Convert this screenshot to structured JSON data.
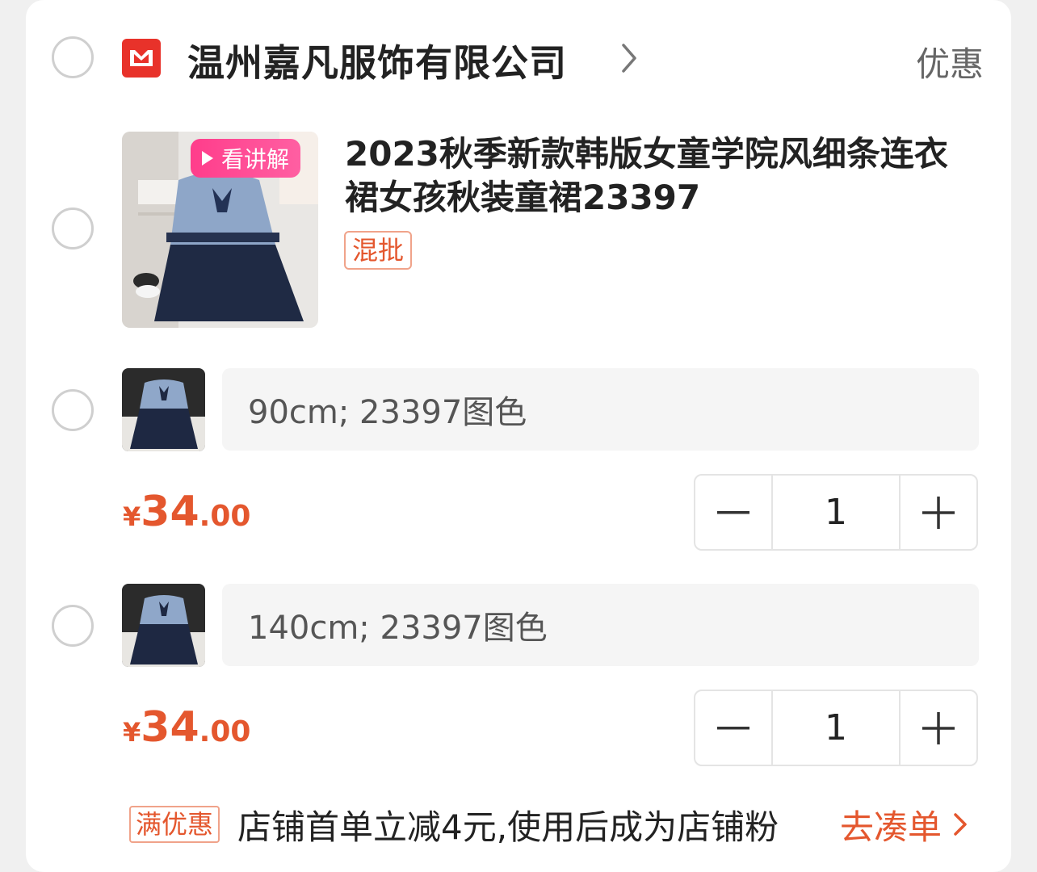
{
  "shop": {
    "name": "温州嘉凡服饰有限公司",
    "promo_link": "优惠"
  },
  "product": {
    "video_badge": "看讲解",
    "title": "2023秋季新款韩版女童学院风细条连衣裙女孩秋装童裙23397",
    "tag": "混批"
  },
  "skus": [
    {
      "spec": "90cm; 23397图色",
      "price_symbol": "¥",
      "price_int": "34",
      "price_dec": ".00",
      "quantity": "1"
    },
    {
      "spec": "140cm; 23397图色",
      "price_symbol": "¥",
      "price_int": "34",
      "price_dec": ".00",
      "quantity": "1"
    }
  ],
  "bottom_promo": {
    "tag": "满优惠",
    "text": "店铺首单立减4元,使用后成为店铺粉",
    "action": "去凑单"
  },
  "colors": {
    "accent": "#e4572e",
    "logo_red": "#e8322a",
    "video_badge": "#ff4d94"
  }
}
